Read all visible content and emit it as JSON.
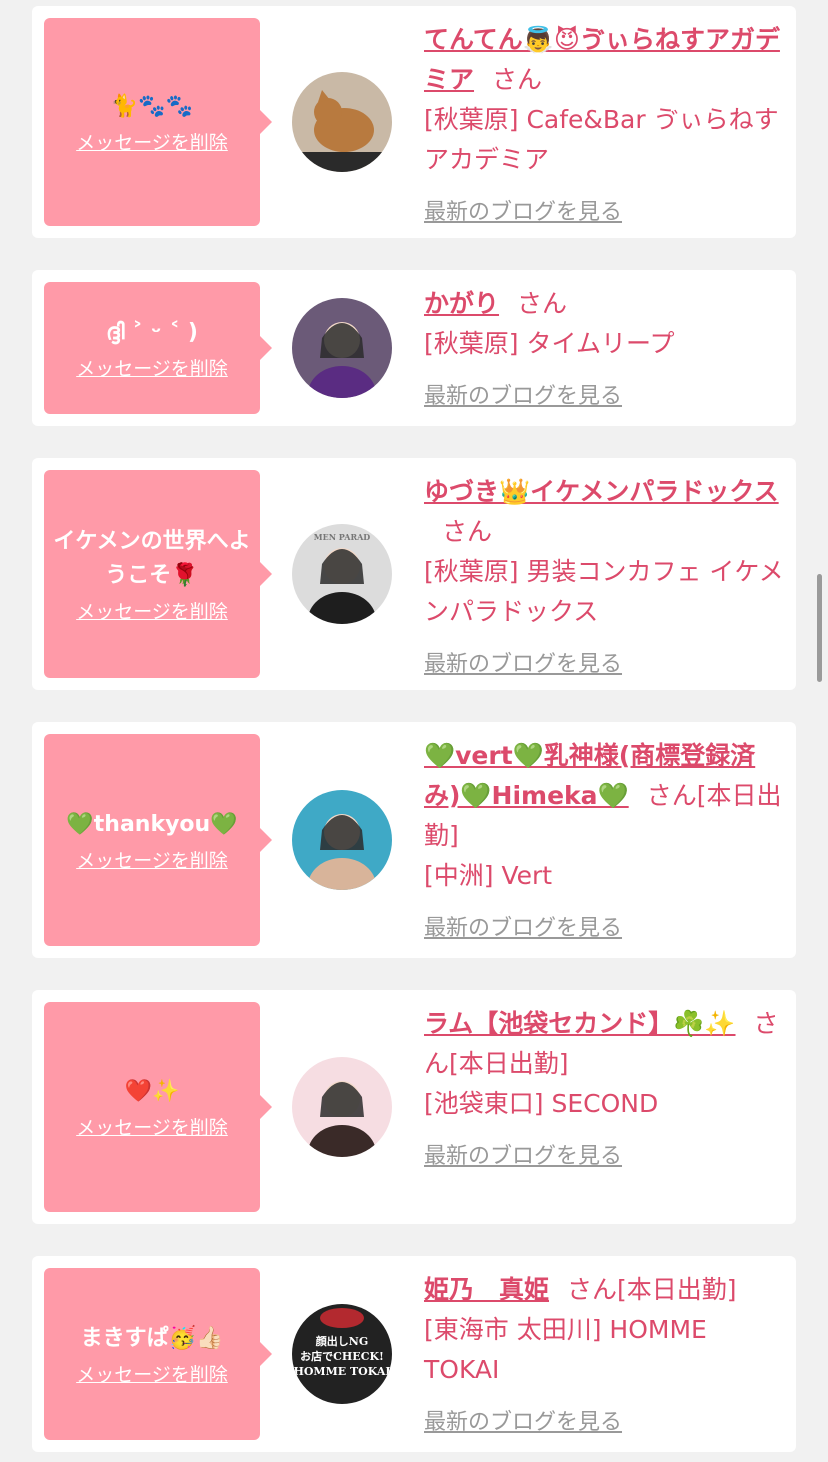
{
  "items": [
    {
      "message": "🐈🐾🐾",
      "delete_label": "メッセージを削除",
      "name": "てんてん👼😈ゔぃらねすアガデミア",
      "san": "さん",
      "status": "",
      "shop": "[秋葉原] Cafe&Bar ゔぃらねすアカデミア",
      "blog_label": "最新のブログを見る",
      "avatar_icon": "cat-photo",
      "avatar_colors": [
        "#c9b9a6",
        "#b87a3f"
      ]
    },
    {
      "message": "ദ്ദി ˃ ᵕ ˂ )",
      "delete_label": "メッセージを削除",
      "name": "かがり",
      "san": "さん",
      "status": "",
      "shop": "[秋葉原] タイムリープ",
      "blog_label": "最新のブログを見る",
      "avatar_icon": "person-photo",
      "avatar_colors": [
        "#6b5a78",
        "#5a2c82"
      ]
    },
    {
      "message": "イケメンの世界へようこそ🌹",
      "delete_label": "メッセージを削除",
      "name": "ゆづき👑イケメンパラドックス",
      "san": "さん",
      "status": "",
      "shop": "[秋葉原] 男装コンカフェ イケメンパラドックス",
      "blog_label": "最新のブログを見る",
      "avatar_icon": "person-photo",
      "avatar_colors": [
        "#dcdcdc",
        "#1e1e1e"
      ],
      "avatar_text": "MEN PARAD"
    },
    {
      "message": "💚thankyou💚",
      "delete_label": "メッセージを削除",
      "name": "💚vert💚乳神様(商標登録済み)💚Himeka💚",
      "san": "さん",
      "status": "[本日出勤]",
      "shop": "[中洲] Vert",
      "blog_label": "最新のブログを見る",
      "avatar_icon": "person-photo",
      "avatar_colors": [
        "#3fa9c6",
        "#d8b49a"
      ]
    },
    {
      "message": "❤️✨",
      "delete_label": "メッセージを削除",
      "name": "ラム【池袋セカンド】☘️✨",
      "san": "さん",
      "status": "[本日出勤]",
      "shop": "[池袋東口] SECOND",
      "blog_label": "最新のブログを見る",
      "avatar_icon": "person-photo",
      "avatar_colors": [
        "#f6dde2",
        "#3a2a28"
      ]
    },
    {
      "message": "まきすぱ🥳👍🏻",
      "delete_label": "メッセージを削除",
      "name": "姫乃　真姫",
      "san": "さん",
      "status": "[本日出勤]",
      "shop": "[東海市 太田川] HOMME TOKAI",
      "blog_label": "最新のブログを見る",
      "avatar_icon": "shop-logo",
      "avatar_colors": [
        "#222222",
        "#e8e8e8"
      ],
      "avatar_text": "顔出しNG\nお店でCHECK!\nHOMME TOKAI"
    }
  ]
}
